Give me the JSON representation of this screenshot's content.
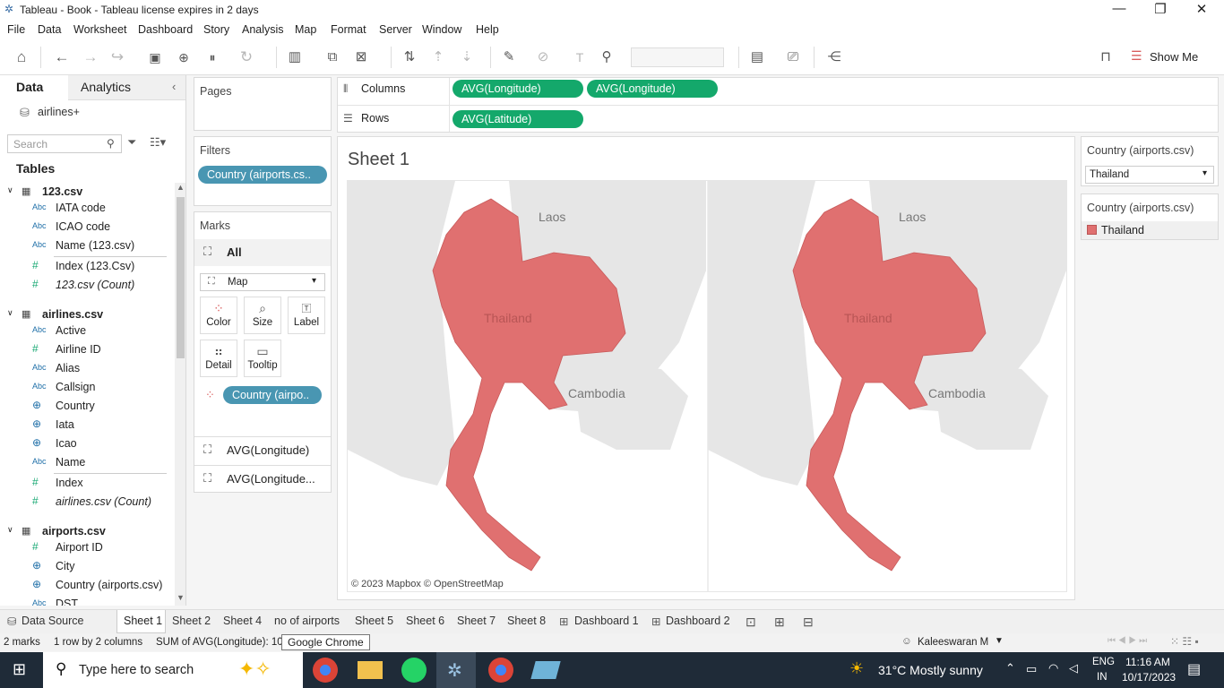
{
  "window": {
    "title": "Tableau - Book - Tableau license expires in 2 days",
    "minimize": "—",
    "restore": "❐",
    "close": "✕"
  },
  "menu": [
    "File",
    "Data",
    "Worksheet",
    "Dashboard",
    "Story",
    "Analysis",
    "Map",
    "Format",
    "Server",
    "Window",
    "Help"
  ],
  "toolbar": {
    "show_me": "Show Me"
  },
  "data_pane": {
    "tabs": [
      "Data",
      "Analytics"
    ],
    "datasource": "airlines+",
    "search_placeholder": "Search",
    "tables_heading": "Tables",
    "tables": [
      {
        "name": "123.csv",
        "fields": [
          {
            "icon": "Abc",
            "name": "IATA code"
          },
          {
            "icon": "Abc",
            "name": "ICAO code"
          },
          {
            "icon": "Abc",
            "name": "Name (123.csv)"
          },
          {
            "icon": "#",
            "name": "Index (123.Csv)"
          },
          {
            "icon": "#",
            "name": "123.csv (Count)",
            "italic": true
          }
        ]
      },
      {
        "name": "airlines.csv",
        "fields": [
          {
            "icon": "Abc",
            "name": "Active"
          },
          {
            "icon": "#",
            "name": "Airline ID"
          },
          {
            "icon": "Abc",
            "name": "Alias"
          },
          {
            "icon": "Abc",
            "name": "Callsign"
          },
          {
            "icon": "globe",
            "name": "Country"
          },
          {
            "icon": "globe",
            "name": "Iata"
          },
          {
            "icon": "globe",
            "name": "Icao"
          },
          {
            "icon": "Abc",
            "name": "Name"
          },
          {
            "icon": "#",
            "name": "Index"
          },
          {
            "icon": "#",
            "name": "airlines.csv (Count)",
            "italic": true
          }
        ]
      },
      {
        "name": "airports.csv",
        "fields": [
          {
            "icon": "#",
            "name": "Airport ID"
          },
          {
            "icon": "globe",
            "name": "City"
          },
          {
            "icon": "globe",
            "name": "Country (airports.csv)"
          },
          {
            "icon": "Abc",
            "name": "DST"
          }
        ]
      }
    ]
  },
  "shelves": {
    "pages_label": "Pages",
    "filters_label": "Filters",
    "filter_pill": "Country (airports.cs..",
    "columns_label": "Columns",
    "rows_label": "Rows",
    "columns": [
      "AVG(Longitude)",
      "AVG(Longitude)"
    ],
    "rows": [
      "AVG(Latitude)"
    ]
  },
  "marks": {
    "label": "Marks",
    "all": "All",
    "type": "Map",
    "buttons": [
      "Color",
      "Size",
      "Label",
      "Detail",
      "Tooltip"
    ],
    "color_pill": "Country (airpo..",
    "cards": [
      "AVG(Longitude)",
      "AVG(Longitude..."
    ]
  },
  "view": {
    "sheet_title": "Sheet 1",
    "map_labels": [
      "Laos",
      "Thailand",
      "Cambodia"
    ],
    "attribution": "© 2023 Mapbox © OpenStreetMap"
  },
  "filter_card": {
    "title": "Country (airports.csv)",
    "value": "Thailand"
  },
  "legend_card": {
    "title": "Country (airports.csv)",
    "item": "Thailand",
    "color": "#e07070"
  },
  "sheet_tabs": [
    "Data Source",
    "Sheet 1",
    "Sheet 2",
    "Sheet 4",
    "no of airports",
    "Sheet 5",
    "Sheet 6",
    "Sheet 7",
    "Sheet 8",
    "Dashboard 1",
    "Dashboard 2"
  ],
  "status": {
    "marks": "2 marks",
    "dims": "1 row by 2 columns",
    "sum": "SUM of AVG(Longitude): 100",
    "tooltip": "Google Chrome",
    "user": "Kaleeswaran M"
  },
  "taskbar": {
    "search": "Type here to search",
    "weather": "31°C  Mostly sunny",
    "lang1": "ENG",
    "lang2": "IN",
    "time": "11:16 AM",
    "date": "10/17/2023"
  }
}
